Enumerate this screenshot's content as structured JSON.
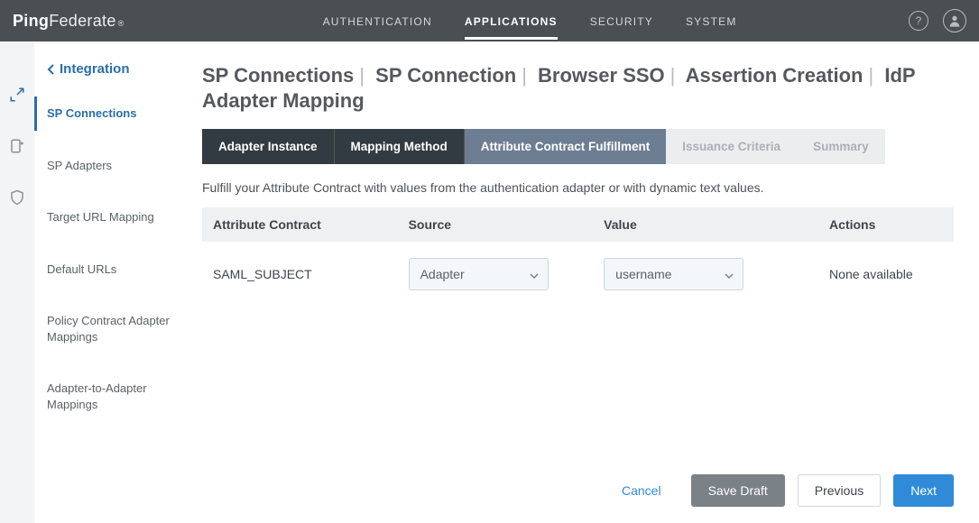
{
  "brand": {
    "ping": "Ping",
    "fed": "Federate",
    "reg": "®"
  },
  "topnav": [
    "AUTHENTICATION",
    "APPLICATIONS",
    "SECURITY",
    "SYSTEM"
  ],
  "sidebar": {
    "back_label": "Integration",
    "items": [
      "SP Connections",
      "SP Adapters",
      "Target URL Mapping",
      "Default URLs",
      "Policy Contract Adapter Mappings",
      "Adapter-to-Adapter Mappings"
    ]
  },
  "breadcrumb": [
    "SP Connections",
    "SP Connection",
    "Browser SSO",
    "Assertion Creation",
    "IdP Adapter Mapping"
  ],
  "wizard_tabs": [
    {
      "label": "Adapter Instance",
      "state": "done"
    },
    {
      "label": "Mapping Method",
      "state": "done"
    },
    {
      "label": "Attribute Contract Fulfillment",
      "state": "current"
    },
    {
      "label": "Issuance Criteria",
      "state": "todo"
    },
    {
      "label": "Summary",
      "state": "todo"
    }
  ],
  "help_text": "Fulfill your Attribute Contract with values from the authentication adapter or with dynamic text values.",
  "table": {
    "headers": {
      "attr": "Attribute Contract",
      "source": "Source",
      "value": "Value",
      "actions": "Actions"
    },
    "rows": [
      {
        "attr": "SAML_SUBJECT",
        "source": "Adapter",
        "value": "username",
        "actions": "None available"
      }
    ]
  },
  "footer": {
    "cancel": "Cancel",
    "save_draft": "Save Draft",
    "previous": "Previous",
    "next": "Next"
  },
  "help_tooltip": "?"
}
